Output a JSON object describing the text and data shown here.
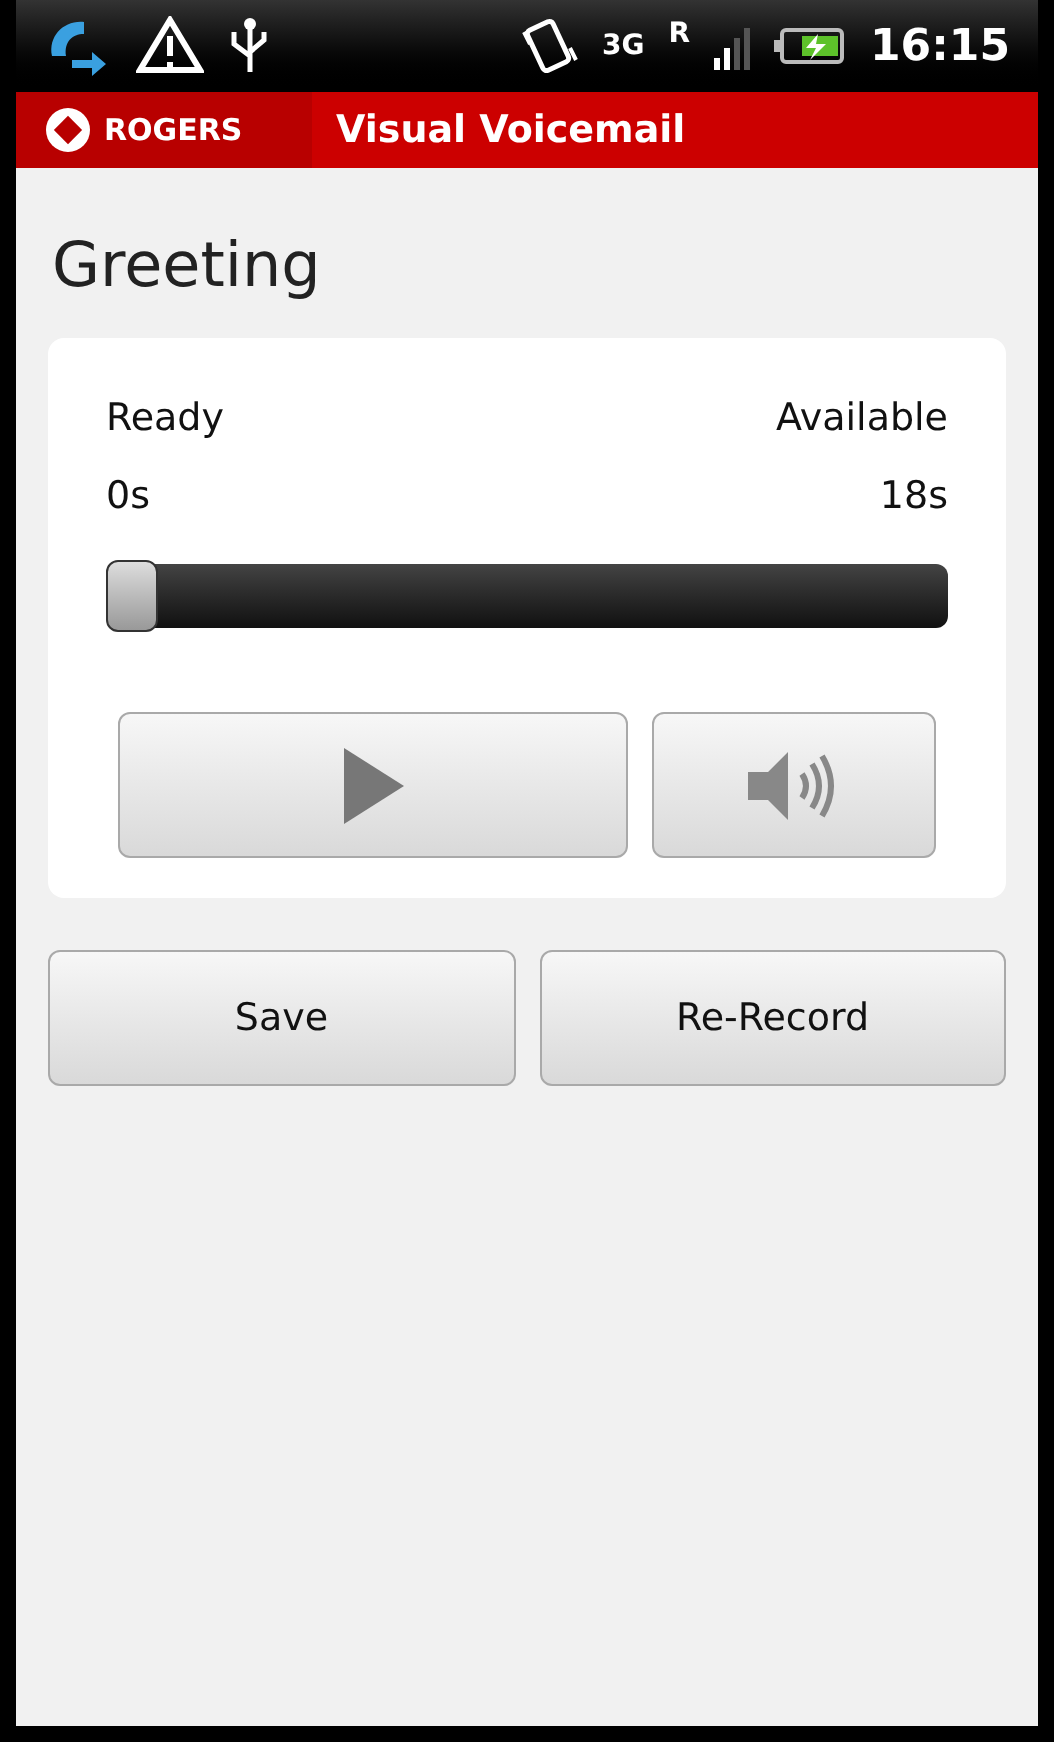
{
  "status_bar": {
    "network": "3G",
    "roaming": "R",
    "time": "16:15"
  },
  "app_bar": {
    "logo": "ROGERS",
    "title": "Visual Voicemail"
  },
  "heading": "Greeting",
  "player": {
    "state": "Ready",
    "remaining_label": "Available",
    "elapsed": "0s",
    "total": "18s",
    "level": 0
  },
  "buttons": [
    "Save",
    "Re-Record"
  ]
}
